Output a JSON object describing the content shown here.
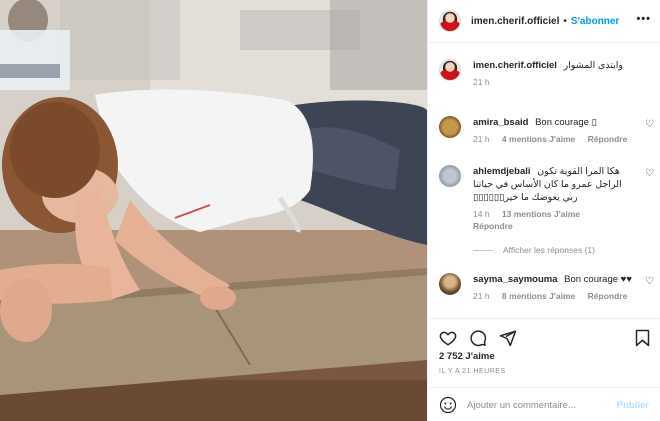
{
  "post": {
    "author": "imen.cherif.officiel",
    "separator": "•",
    "follow_label": "S'abonner",
    "more_label": "•••",
    "caption": "وابتدى المشوار",
    "caption_time": "21 h",
    "photo_alt": "Woman doing a plank exercise on a gym mat"
  },
  "comments": [
    {
      "username": "amira_bsaid",
      "text": "Bon courage ▯",
      "time": "21 h",
      "likes": "4 mentions J'aime",
      "reply": "Répondre",
      "avatar": "gold-avatar",
      "heart": "heart-icon"
    },
    {
      "username": "ahlemdjebali",
      "text": "هكا المرا القوية تكون الراجل عمرو ما كان الأساس في حياتنا ربي يعوضك ما خير▯▯▯▯▯▯",
      "time": "14 h",
      "likes": "13 mentions J'aime",
      "reply": "Répondre",
      "avatar": "gray-avatar",
      "heart": "heart-icon"
    },
    {
      "username": "sayma_saymouma",
      "text": "Bon courage ♥♥",
      "time": "21 h",
      "likes": "8 mentions J'aime",
      "reply": "Répondre",
      "avatar": "brown-avatar",
      "heart": "heart-icon"
    }
  ],
  "show_replies": "Afficher les réponses (1)",
  "actions": {
    "likes": "2 752 J'aime",
    "time": "IL Y A 21 HEURES",
    "comment_placeholder": "Ajouter un commentaire...",
    "publish": "Publier"
  },
  "colors": {
    "accent": "#0095f6",
    "publish_disabled": "#b2dffc",
    "muted": "#8e8e8e",
    "text": "#262626"
  }
}
